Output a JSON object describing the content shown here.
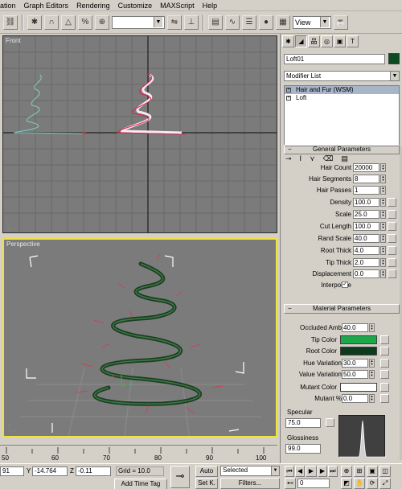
{
  "menu": [
    "ation",
    "Graph Editors",
    "Rendering",
    "Customize",
    "MAXScript",
    "Help"
  ],
  "toolbar": {
    "view_select": "View"
  },
  "viewports": {
    "front_label": "Front",
    "perspective_label": "Perspective"
  },
  "timeline": {
    "ticks": [
      "50",
      "60",
      "70",
      "80",
      "90",
      "100"
    ]
  },
  "status": {
    "x_value": "91",
    "y_label": "Y",
    "y_value": "-14.764",
    "z_label": "Z",
    "z_value": "-0.11",
    "grid": "Grid = 10.0",
    "add_time_tag": "Add Time Tag",
    "auto": "Auto",
    "set_key": "Set K.",
    "selected": "Selected",
    "filters": "Filters...",
    "frame": "0"
  },
  "panel": {
    "object_name": "Loft01",
    "object_color": "#0c4a24",
    "modifier_list": "Modifier List",
    "stack": [
      {
        "label": "Hair and Fur (WSM)",
        "selected": true
      },
      {
        "label": "Loft",
        "selected": false
      }
    ],
    "general": {
      "title": "General Parameters",
      "params": [
        {
          "label": "Hair Count",
          "value": "20000"
        },
        {
          "label": "Hair Segments",
          "value": "8"
        },
        {
          "label": "Hair Passes",
          "value": "1"
        },
        {
          "label": "Density",
          "value": "100.0"
        },
        {
          "label": "Scale",
          "value": "25.0"
        },
        {
          "label": "Cut Length",
          "value": "100.0"
        },
        {
          "label": "Rand Scale",
          "value": "40.0"
        },
        {
          "label": "Root Thick",
          "value": "4.0"
        },
        {
          "label": "Tip Thick",
          "value": "2.0"
        },
        {
          "label": "Displacement",
          "value": "0.0"
        }
      ],
      "interpolate": "Interpolate"
    },
    "material": {
      "title": "Material Parameters",
      "occluded_amb": {
        "label": "Occluded Amb",
        "value": "40.0"
      },
      "tip_color": {
        "label": "Tip Color",
        "color": "#1aa84a"
      },
      "root_color": {
        "label": "Root Color",
        "color": "#0e3b1e"
      },
      "hue_variation": {
        "label": "Hue Variation",
        "value": "30.0"
      },
      "value_variation": {
        "label": "Value Variation",
        "value": "50.0"
      },
      "mutant_color": {
        "label": "Mutant Color",
        "color": "#ffffff"
      },
      "mutant_pct": {
        "label": "Mutant %",
        "value": "0.0"
      },
      "specular": {
        "label": "Specular",
        "value": "75.0"
      },
      "glossiness": {
        "label": "Glossiness",
        "value": "99.0"
      }
    }
  }
}
